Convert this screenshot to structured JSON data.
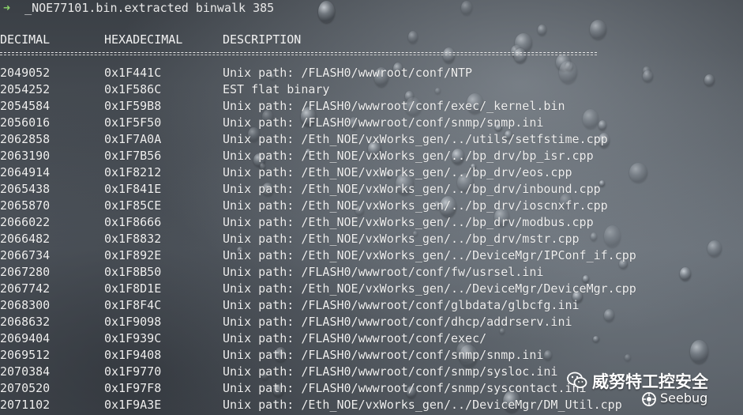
{
  "terminal": {
    "prompt_arrow": "➜",
    "prompt": "  _NOE77101.bin.extracted binwalk 385"
  },
  "columns": {
    "decimal": "DECIMAL",
    "hexadecimal": "HEXADECIMAL",
    "description": "DESCRIPTION"
  },
  "rows": [
    {
      "dec": "2049052",
      "hex": "0x1F441C",
      "desc": "Unix path: /FLASH0/wwwroot/conf/NTP"
    },
    {
      "dec": "2054252",
      "hex": "0x1F586C",
      "desc": "EST flat binary"
    },
    {
      "dec": "2054584",
      "hex": "0x1F59B8",
      "desc": "Unix path: /FLASH0/wwwroot/conf/exec/_kernel.bin"
    },
    {
      "dec": "2056016",
      "hex": "0x1F5F50",
      "desc": "Unix path: /FLASH0/wwwroot/conf/snmp/snmp.ini"
    },
    {
      "dec": "2062858",
      "hex": "0x1F7A0A",
      "desc": "Unix path: /Eth_NOE/vxWorks_gen/../utils/setfstime.cpp"
    },
    {
      "dec": "2063190",
      "hex": "0x1F7B56",
      "desc": "Unix path: /Eth_NOE/vxWorks_gen/../bp_drv/bp_isr.cpp"
    },
    {
      "dec": "2064914",
      "hex": "0x1F8212",
      "desc": "Unix path: /Eth_NOE/vxWorks_gen/../bp_drv/eos.cpp"
    },
    {
      "dec": "2065438",
      "hex": "0x1F841E",
      "desc": "Unix path: /Eth_NOE/vxWorks_gen/../bp_drv/inbound.cpp"
    },
    {
      "dec": "2065870",
      "hex": "0x1F85CE",
      "desc": "Unix path: /Eth_NOE/vxWorks_gen/../bp_drv/ioscnxfr.cpp"
    },
    {
      "dec": "2066022",
      "hex": "0x1F8666",
      "desc": "Unix path: /Eth_NOE/vxWorks_gen/../bp_drv/modbus.cpp"
    },
    {
      "dec": "2066482",
      "hex": "0x1F8832",
      "desc": "Unix path: /Eth_NOE/vxWorks_gen/../bp_drv/mstr.cpp"
    },
    {
      "dec": "2066734",
      "hex": "0x1F892E",
      "desc": "Unix path: /Eth_NOE/vxWorks_gen/../DeviceMgr/IPConf_if.cpp"
    },
    {
      "dec": "2067280",
      "hex": "0x1F8B50",
      "desc": "Unix path: /FLASH0/wwwroot/conf/fw/usrsel.ini"
    },
    {
      "dec": "2067742",
      "hex": "0x1F8D1E",
      "desc": "Unix path: /Eth_NOE/vxWorks_gen/../DeviceMgr/DeviceMgr.cpp"
    },
    {
      "dec": "2068300",
      "hex": "0x1F8F4C",
      "desc": "Unix path: /FLASH0/wwwroot/conf/glbdata/glbcfg.ini"
    },
    {
      "dec": "2068632",
      "hex": "0x1F9098",
      "desc": "Unix path: /FLASH0/wwwroot/conf/dhcp/addrserv.ini"
    },
    {
      "dec": "2069404",
      "hex": "0x1F939C",
      "desc": "Unix path: /FLASH0/wwwroot/conf/exec/"
    },
    {
      "dec": "2069512",
      "hex": "0x1F9408",
      "desc": "Unix path: /FLASH0/wwwroot/conf/snmp/snmp.ini"
    },
    {
      "dec": "2070384",
      "hex": "0x1F9770",
      "desc": "Unix path: /FLASH0/wwwroot/conf/snmp/sysloc.ini"
    },
    {
      "dec": "2070520",
      "hex": "0x1F97F8",
      "desc": "Unix path: /FLASH0/wwwroot/conf/snmp/syscontact.ini"
    },
    {
      "dec": "2071102",
      "hex": "0x1F9A3E",
      "desc": "Unix path: /Eth_NOE/vxWorks_gen/../DeviceMgr/DM_Util.cpp"
    }
  ],
  "watermark": {
    "title": "威努特工控安全",
    "subtitle": "Seebug",
    "icon": "wechat-icon",
    "logo_icon": "seebug-logo-icon"
  }
}
